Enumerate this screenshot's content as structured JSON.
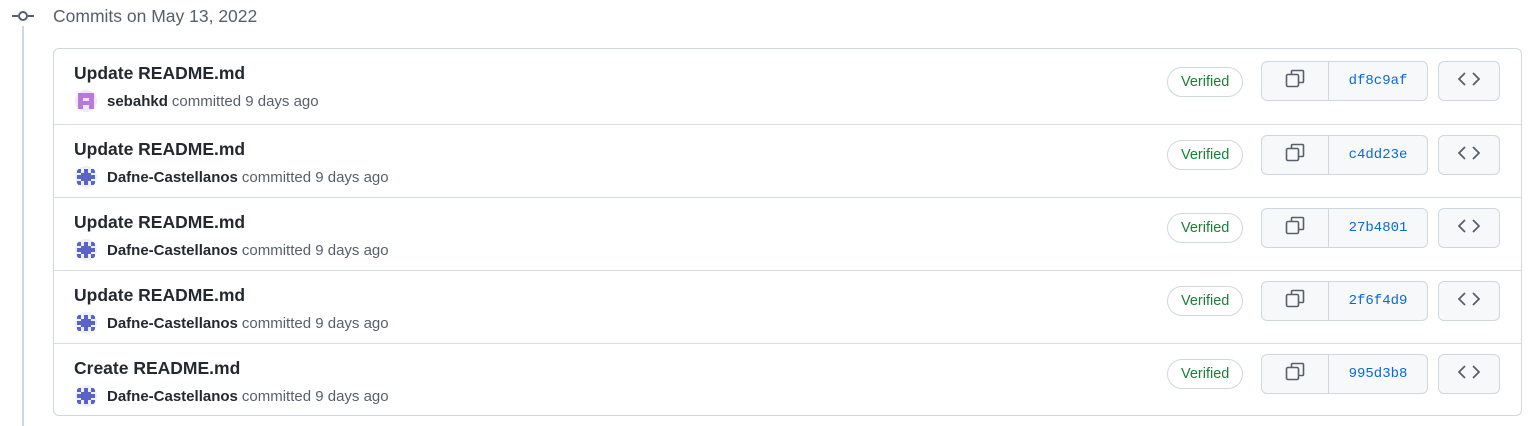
{
  "group": {
    "title": "Commits on May 13, 2022"
  },
  "commits": [
    {
      "message": "Update README.md",
      "author": "sebahkd",
      "meta": "committed 9 days ago",
      "badge": "Verified",
      "sha": "df8c9af",
      "avatar_icon": "identicon-purple"
    },
    {
      "message": "Update README.md",
      "author": "Dafne-Castellanos",
      "meta": "committed 9 days ago",
      "badge": "Verified",
      "sha": "c4dd23e",
      "avatar_icon": "identicon-blue"
    },
    {
      "message": "Update README.md",
      "author": "Dafne-Castellanos",
      "meta": "committed 9 days ago",
      "badge": "Verified",
      "sha": "27b4801",
      "avatar_icon": "identicon-blue"
    },
    {
      "message": "Update README.md",
      "author": "Dafne-Castellanos",
      "meta": "committed 9 days ago",
      "badge": "Verified",
      "sha": "2f6f4d9",
      "avatar_icon": "identicon-blue"
    },
    {
      "message": "Create README.md",
      "author": "Dafne-Castellanos",
      "meta": "committed 9 days ago",
      "badge": "Verified",
      "sha": "995d3b8",
      "avatar_icon": "identicon-blue"
    }
  ],
  "icons": {
    "timeline": "git-commit-icon",
    "copy": "copy-icon",
    "browse": "code-icon"
  },
  "colors": {
    "verified": "#1a7f37",
    "sha": "#0969da",
    "border": "#d0d7de",
    "identicon_purple": "#b77ad8",
    "identicon_blue": "#5a64c8"
  }
}
